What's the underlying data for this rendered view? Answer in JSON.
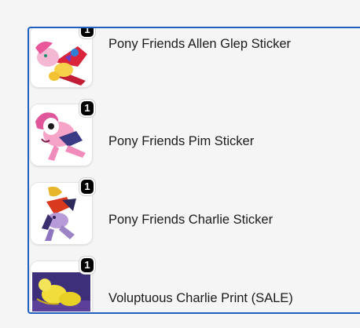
{
  "cart": {
    "border_color": "#1e5fbf",
    "items": [
      {
        "title": "Pony Friends Allen Glep Sticker",
        "qty": "1",
        "thumb_icon": "pony-sticker-yellow-red"
      },
      {
        "title": "Pony Friends Pim Sticker",
        "qty": "1",
        "thumb_icon": "pony-sticker-pink"
      },
      {
        "title": "Pony Friends Charlie Sticker",
        "qty": "1",
        "thumb_icon": "pony-sticker-purple-red"
      },
      {
        "title": "Voluptuous Charlie Print (SALE)",
        "qty": "1",
        "thumb_icon": "print-yellow-on-purple"
      }
    ]
  }
}
